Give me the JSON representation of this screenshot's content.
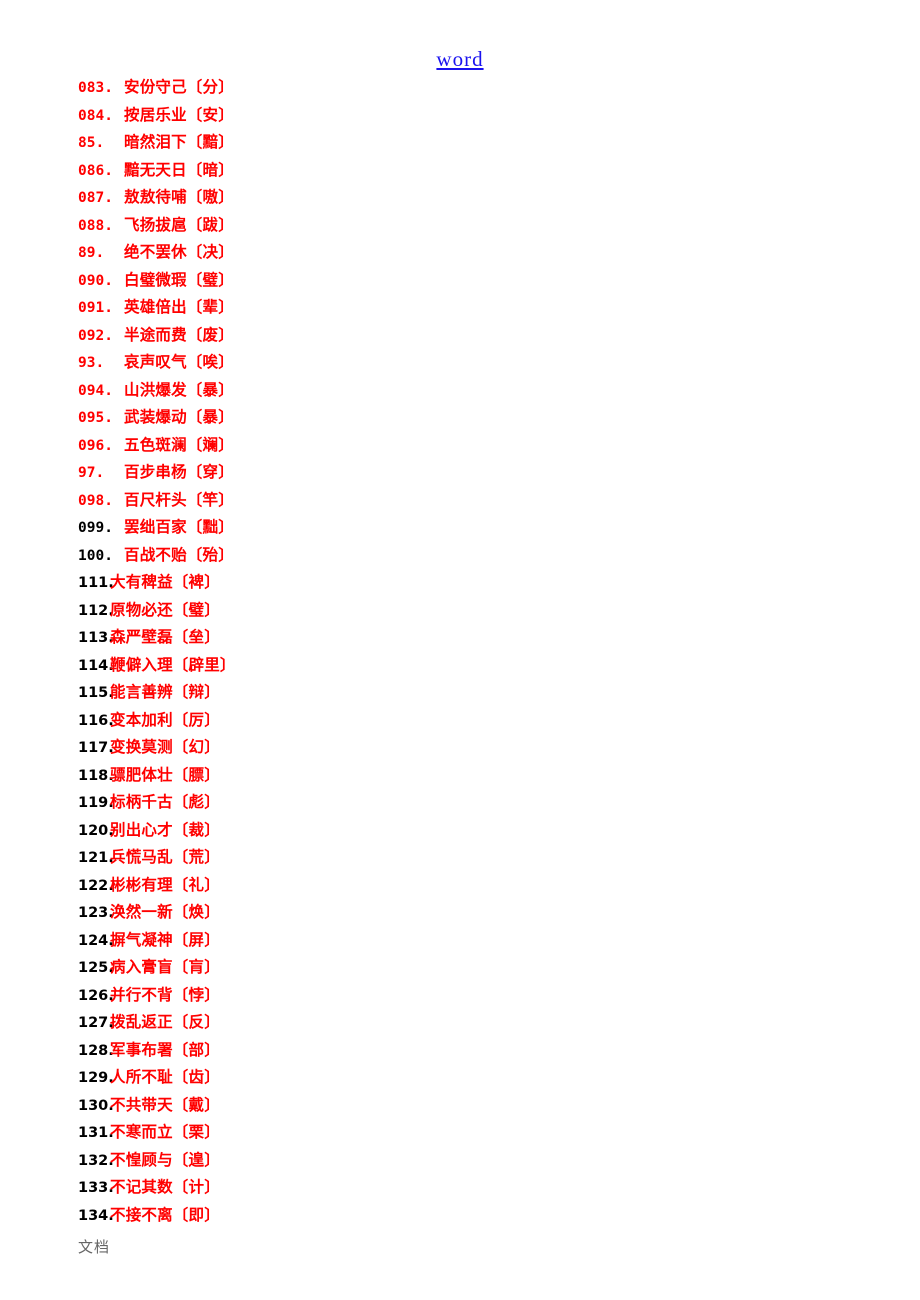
{
  "document": {
    "header_link_text": "word",
    "footer_watermark": "文档",
    "colors": {
      "entry_red": "#ff0000",
      "entry_black": "#000000",
      "header_blue": "#1a12ef",
      "watermark_gray": "#666666",
      "page_background": "#ffffff"
    }
  },
  "groups": [
    {
      "id": "group-a",
      "entries": [
        {
          "num": "083.",
          "text": "安份守己〔分〕",
          "num_color": "red",
          "text_color": "red"
        },
        {
          "num": "084.",
          "text": "按居乐业〔安〕",
          "num_color": "red",
          "text_color": "red"
        },
        {
          "num": "85.",
          "text": "暗然泪下〔黯〕",
          "num_color": "red",
          "text_color": "red"
        },
        {
          "num": "086.",
          "text": "黯无天日〔暗〕",
          "num_color": "red",
          "text_color": "red"
        },
        {
          "num": "087.",
          "text": "敖敖待哺〔嗷〕",
          "num_color": "red",
          "text_color": "red"
        },
        {
          "num": "088.",
          "text": "飞扬拔扈〔跋〕",
          "num_color": "red",
          "text_color": "red"
        },
        {
          "num": "89.",
          "text": "绝不罢休〔决〕",
          "num_color": "red",
          "text_color": "red"
        },
        {
          "num": "090.",
          "text": "白璧微瑕〔璧〕",
          "num_color": "red",
          "text_color": "red"
        },
        {
          "num": "091.",
          "text": "英雄倍出〔辈〕",
          "num_color": "red",
          "text_color": "red"
        },
        {
          "num": "092.",
          "text": "半途而费〔废〕",
          "num_color": "red",
          "text_color": "red"
        },
        {
          "num": "93.",
          "text": "哀声叹气〔唉〕",
          "num_color": "red",
          "text_color": "red"
        },
        {
          "num": "094.",
          "text": "山洪爆发〔暴〕",
          "num_color": "red",
          "text_color": "red"
        },
        {
          "num": "095.",
          "text": "武装爆动〔暴〕",
          "num_color": "red",
          "text_color": "red"
        },
        {
          "num": "096.",
          "text": "五色斑澜〔斓〕",
          "num_color": "red",
          "text_color": "red"
        },
        {
          "num": "97.",
          "text": "百步串杨〔穿〕",
          "num_color": "red",
          "text_color": "red"
        },
        {
          "num": "098.",
          "text": "百尺杆头〔竿〕",
          "num_color": "red",
          "text_color": "red"
        },
        {
          "num": "099.",
          "text": "罢绌百家〔黜〕",
          "num_color": "black",
          "text_color": "red"
        },
        {
          "num": "100.",
          "text": "百战不贻〔殆〕",
          "num_color": "black",
          "text_color": "red"
        }
      ]
    },
    {
      "id": "group-b",
      "entries": [
        {
          "num": "111.",
          "text": "大有稗益〔裨〕",
          "num_color": "black",
          "text_color": "red"
        },
        {
          "num": "112.",
          "text": "原物必还〔璧〕",
          "num_color": "black",
          "text_color": "red"
        },
        {
          "num": "113.",
          "text": "森严壁磊〔垒〕",
          "num_color": "black",
          "text_color": "red"
        },
        {
          "num": "114.",
          "text": "鞭僻入理〔辟里〕",
          "num_color": "black",
          "text_color": "red"
        },
        {
          "num": "115.",
          "text": "能言善辨〔辩〕",
          "num_color": "black",
          "text_color": "red"
        },
        {
          "num": "116.",
          "text": "变本加利〔厉〕",
          "num_color": "black",
          "text_color": "red"
        },
        {
          "num": "117.",
          "text": "变换莫测〔幻〕",
          "num_color": "black",
          "text_color": "red"
        },
        {
          "num": "118.",
          "text": "骠肥体壮〔膘〕",
          "num_color": "black",
          "text_color": "red"
        },
        {
          "num": "119.",
          "text": "标柄千古〔彪〕",
          "num_color": "black",
          "text_color": "red"
        },
        {
          "num": "120.",
          "text": "别出心才〔裁〕",
          "num_color": "black",
          "text_color": "red"
        },
        {
          "num": "121.",
          "text": "兵慌马乱〔荒〕",
          "num_color": "black",
          "text_color": "red"
        },
        {
          "num": "122.",
          "text": "彬彬有理〔礼〕",
          "num_color": "black",
          "text_color": "red"
        },
        {
          "num": "123.",
          "text": "涣然一新〔焕〕",
          "num_color": "black",
          "text_color": "red"
        },
        {
          "num": "124.",
          "text": "摒气凝神〔屏〕",
          "num_color": "black",
          "text_color": "red"
        },
        {
          "num": "125.",
          "text": "病入膏盲〔肓〕",
          "num_color": "black",
          "text_color": "red"
        },
        {
          "num": "126.",
          "text": "并行不背〔悖〕",
          "num_color": "black",
          "text_color": "red"
        },
        {
          "num": "127.",
          "text": "拨乱返正〔反〕",
          "num_color": "black",
          "text_color": "red"
        },
        {
          "num": "128.",
          "text": "军事布署〔部〕",
          "num_color": "black",
          "text_color": "red"
        },
        {
          "num": "129.",
          "text": "人所不耻〔齿〕",
          "num_color": "black",
          "text_color": "red"
        },
        {
          "num": "130.",
          "text": "不共带天〔戴〕",
          "num_color": "black",
          "text_color": "red"
        },
        {
          "num": "131.",
          "text": "不寒而立〔栗〕",
          "num_color": "black",
          "text_color": "red"
        },
        {
          "num": "132.",
          "text": "不惶顾与〔遑〕",
          "num_color": "black",
          "text_color": "red"
        },
        {
          "num": "133.",
          "text": "不记其数〔计〕",
          "num_color": "black",
          "text_color": "red"
        },
        {
          "num": "134.",
          "text": "不接不离〔即〕",
          "num_color": "black",
          "text_color": "red"
        }
      ]
    }
  ]
}
